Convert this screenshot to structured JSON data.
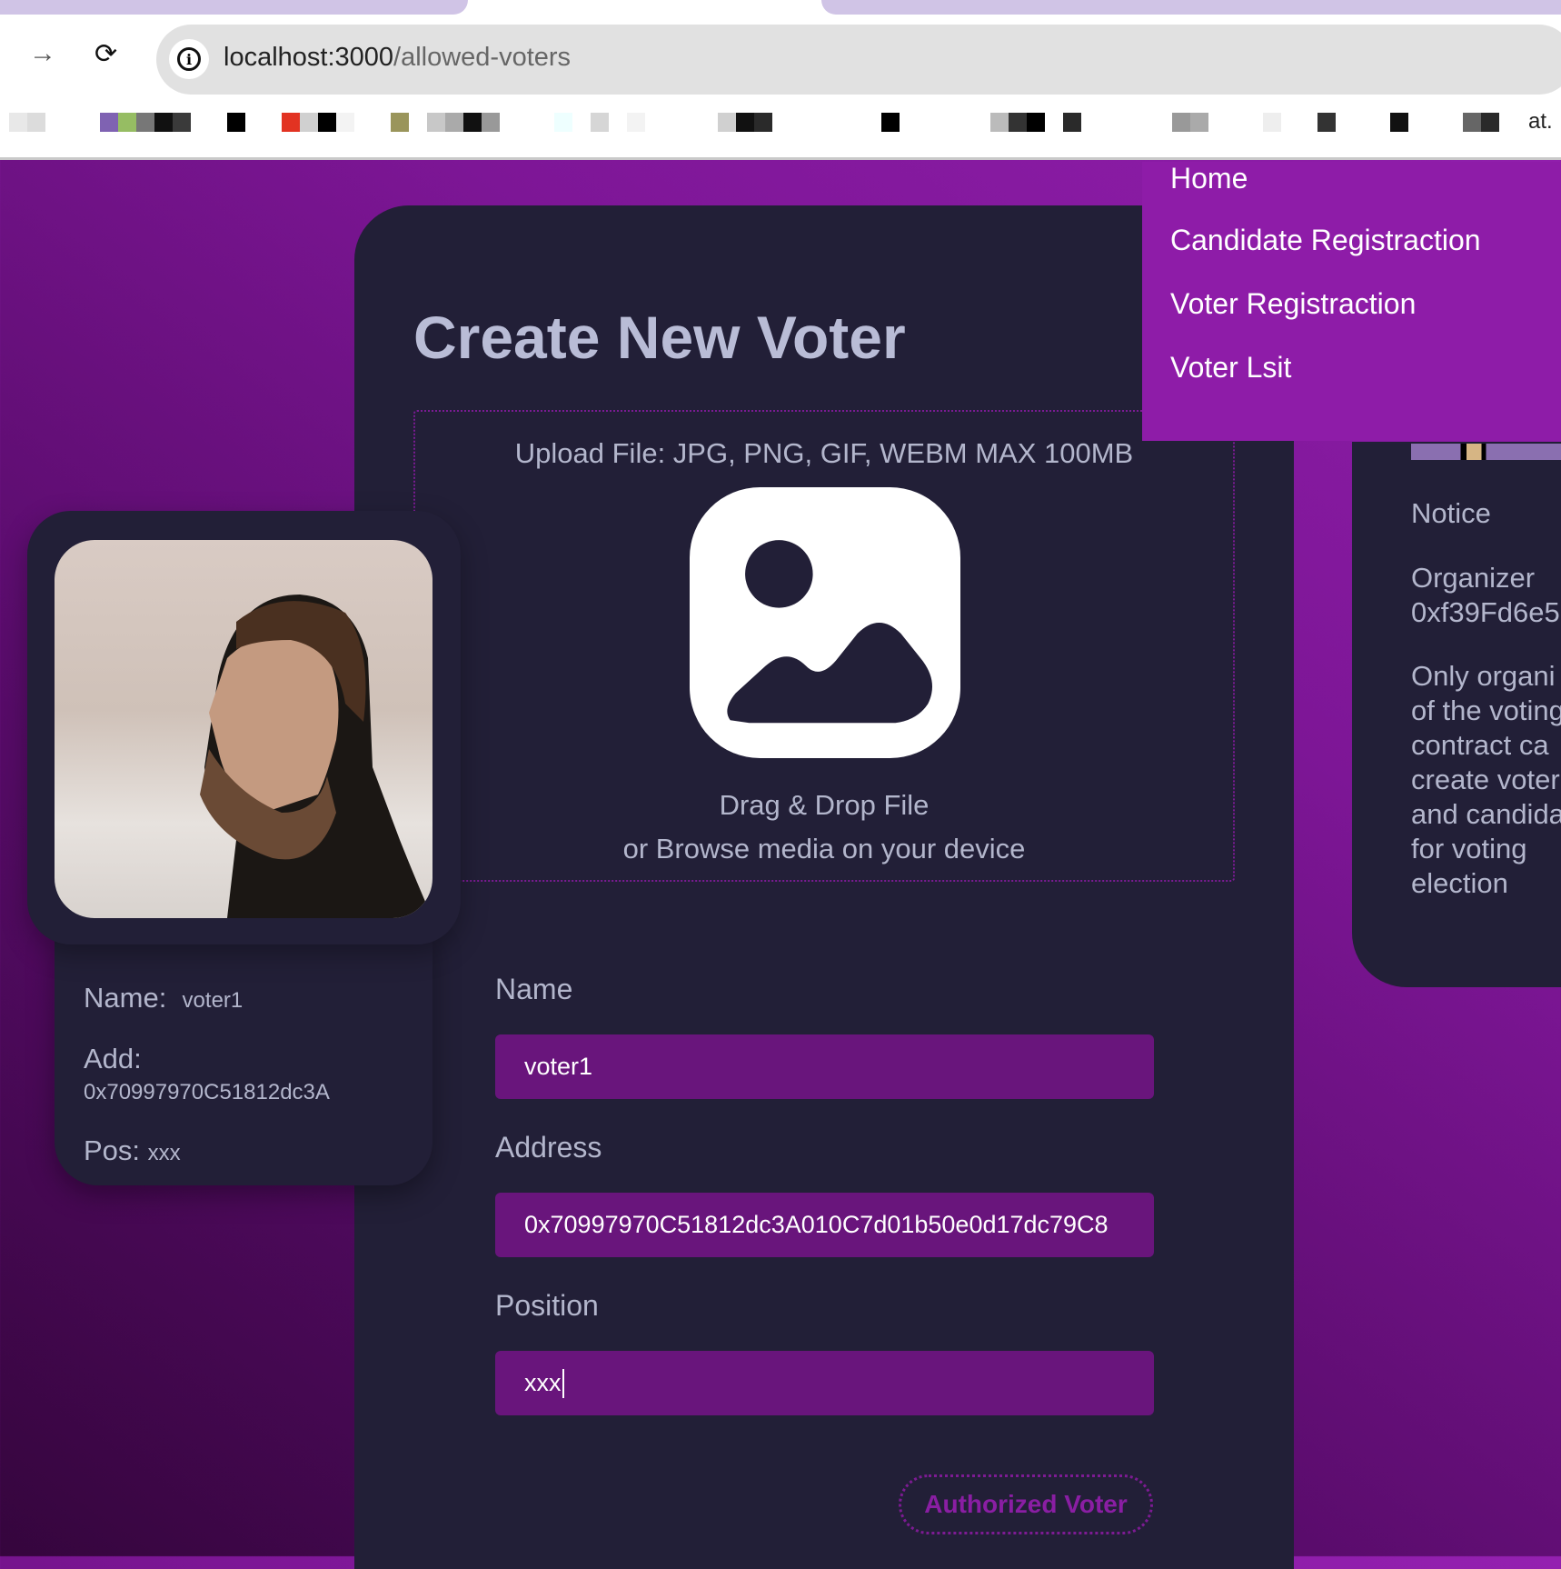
{
  "browser": {
    "url_host": "localhost:3000",
    "url_path": "/allowed-voters",
    "bookmark_tail": "at.",
    "bookmark_colors": [
      "#e8e8e8",
      "#dcdcdc",
      "#7f62b2",
      "#96bd63",
      "#777",
      "#111",
      "#3a3a3a",
      "#000",
      "#e23322",
      "#d0d0d0",
      "#000",
      "#f3f3f3",
      "#9a955b",
      "#c8c8c8",
      "#aaa",
      "#111",
      "#999",
      "#eff",
      "#d6d6d6",
      "#f3f3f3",
      "#d0d0d0",
      "#111",
      "#2a2a2a",
      "#000",
      "#bbb",
      "#333",
      "#000",
      "#2a2a2a",
      "#999",
      "#aaa",
      "#eee",
      "#e1e1e1",
      "#333",
      "#111",
      "#666",
      "#2a2a2a"
    ]
  },
  "menu": {
    "items": [
      {
        "label": "Home"
      },
      {
        "label": "Candidate Registraction"
      },
      {
        "label": "Voter Registraction"
      },
      {
        "label": "Voter Lsit"
      }
    ]
  },
  "form": {
    "title": "Create New Voter",
    "upload_hint": "Upload File: JPG, PNG, GIF, WEBM MAX 100MB",
    "drag_text": "Drag & Drop File",
    "browse_text": "or Browse media on your device",
    "name_label": "Name",
    "name_value": "voter1",
    "address_label": "Address",
    "address_value": "0x70997970C51812dc3A010C7d01b50e0d17dc79C8",
    "position_label": "Position",
    "position_value": "xxx",
    "submit_label": "Authorized Voter"
  },
  "preview": {
    "name_key": "Name:",
    "name_value": "voter1",
    "address_key": "Add:",
    "address_value": "0x70997970C51812dc3A",
    "position_key": "Pos:",
    "position_value": "xxx"
  },
  "notice": {
    "title": "Notice",
    "organizer_label": "Organizer",
    "organizer_address": "0xf39Fd6e5",
    "lines": [
      "Only organi",
      "of the voting",
      "contract ca",
      "create voter",
      "and candida",
      "for voting",
      "election"
    ]
  },
  "colors": {
    "accent": "#8e1ca8",
    "card": "#221f37",
    "input": "#69157c",
    "text": "#b3b6cc"
  }
}
